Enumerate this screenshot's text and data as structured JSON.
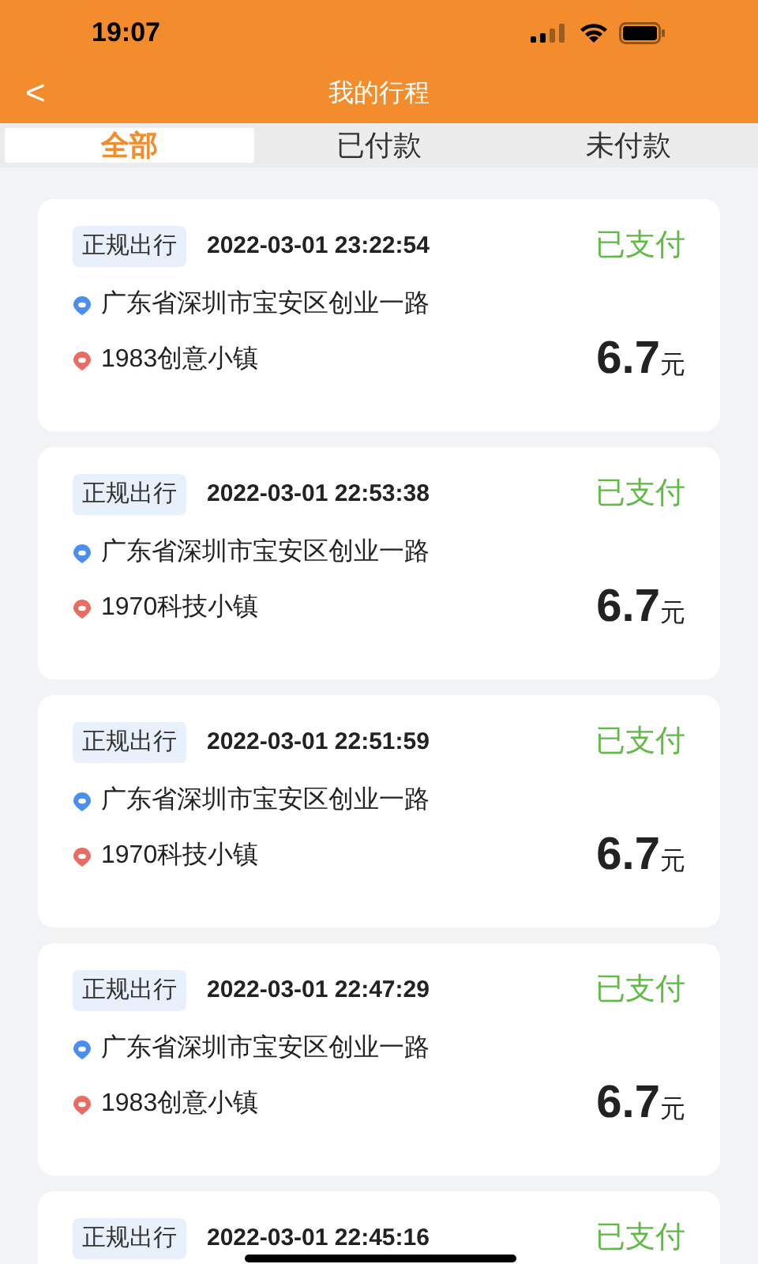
{
  "status_bar": {
    "time": "19:07"
  },
  "nav": {
    "back": "<",
    "title": "我的行程"
  },
  "tabs": [
    {
      "label": "全部",
      "selected": true
    },
    {
      "label": "已付款",
      "selected": false
    },
    {
      "label": "未付款",
      "selected": false
    }
  ],
  "trips": [
    {
      "tag": "正规出行",
      "time": "2022-03-01 23:22:54",
      "status": "已支付",
      "from": "广东省深圳市宝安区创业一路",
      "to": "1983创意小镇",
      "amount": "6.7",
      "unit": "元"
    },
    {
      "tag": "正规出行",
      "time": "2022-03-01 22:53:38",
      "status": "已支付",
      "from": "广东省深圳市宝安区创业一路",
      "to": "1970科技小镇",
      "amount": "6.7",
      "unit": "元"
    },
    {
      "tag": "正规出行",
      "time": "2022-03-01 22:51:59",
      "status": "已支付",
      "from": "广东省深圳市宝安区创业一路",
      "to": "1970科技小镇",
      "amount": "6.7",
      "unit": "元"
    },
    {
      "tag": "正规出行",
      "time": "2022-03-01 22:47:29",
      "status": "已支付",
      "from": "广东省深圳市宝安区创业一路",
      "to": "1983创意小镇",
      "amount": "6.7",
      "unit": "元"
    },
    {
      "tag": "正规出行",
      "time": "2022-03-01 22:45:16",
      "status": "已支付"
    }
  ]
}
